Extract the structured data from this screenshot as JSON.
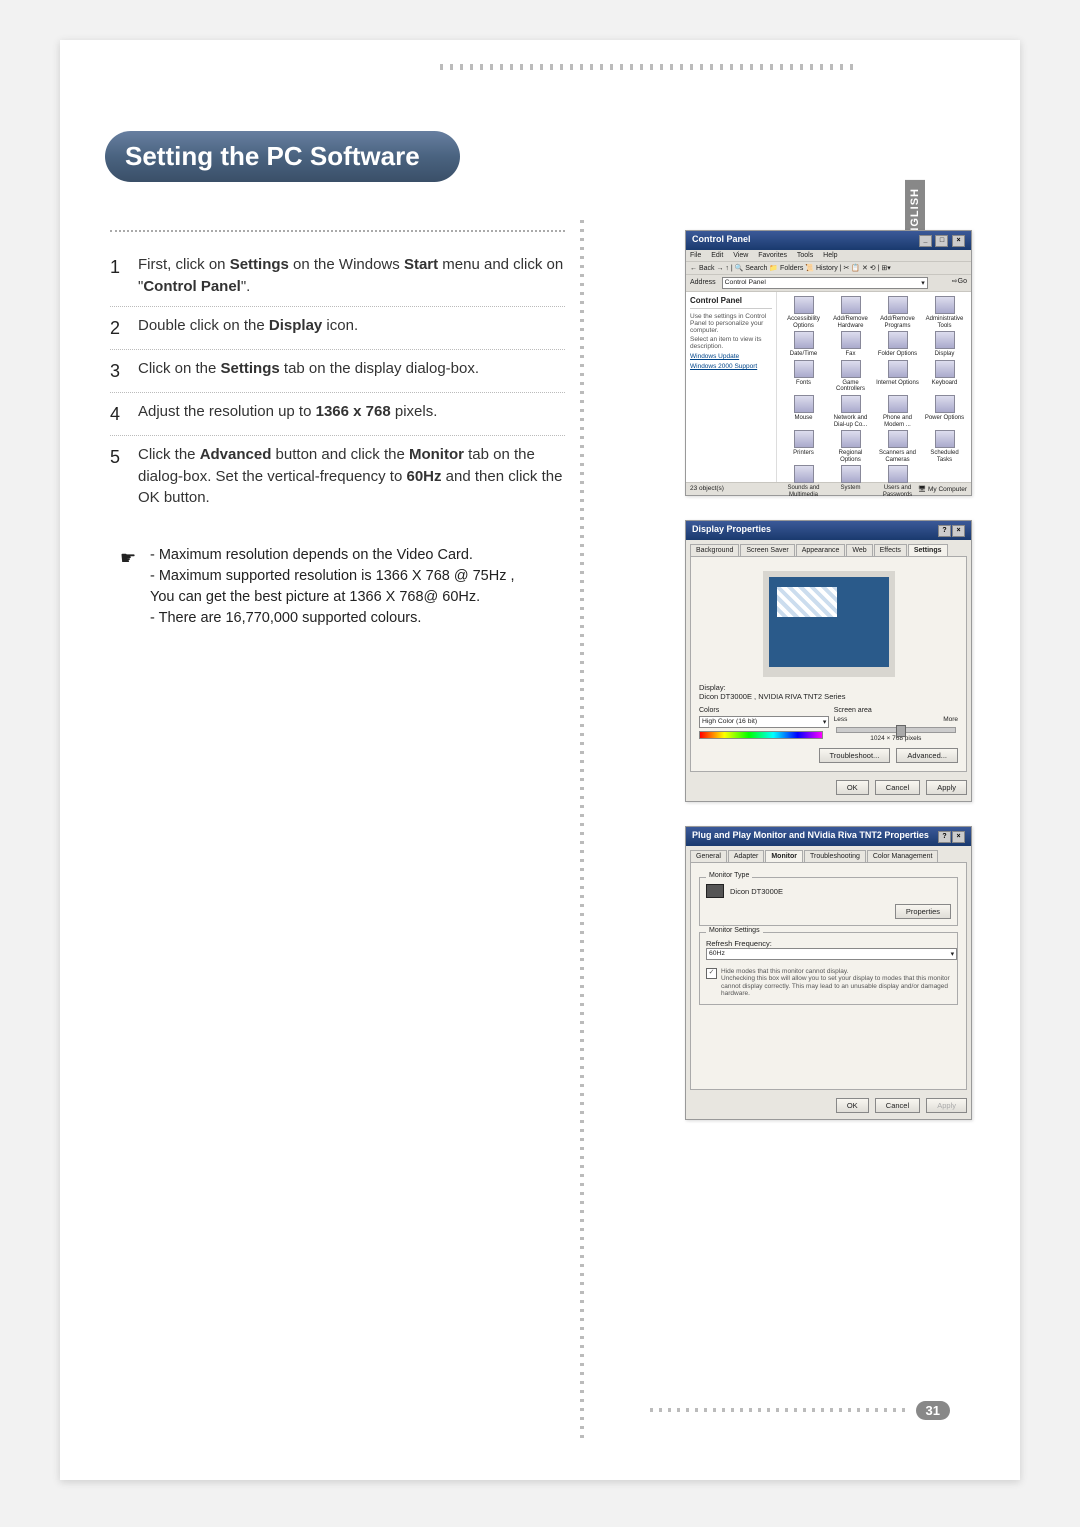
{
  "title": "Setting the PC Software",
  "language_tab": "ENGLISH",
  "page_number": "31",
  "steps": [
    {
      "n": "1",
      "text_pre": "First, click on ",
      "b1": "Settings",
      "mid1": " on the Windows ",
      "b2": "Start",
      "mid2": " menu and click on \"",
      "b3": "Control Panel",
      "post": "\"."
    },
    {
      "n": "2",
      "text_pre": "Double click on the ",
      "b1": "Display",
      "mid1": " icon.",
      "b2": "",
      "mid2": "",
      "b3": "",
      "post": ""
    },
    {
      "n": "3",
      "text_pre": "Click on the ",
      "b1": "Settings",
      "mid1": " tab on the display dialog-box.",
      "b2": "",
      "mid2": "",
      "b3": "",
      "post": ""
    },
    {
      "n": "4",
      "text_pre": "Adjust the resolution up to ",
      "b1": "1366 x 768",
      "mid1": " pixels.",
      "b2": "",
      "mid2": "",
      "b3": "",
      "post": ""
    },
    {
      "n": "5",
      "text_pre": "Click the ",
      "b1": "Advanced",
      "mid1": " button and click the ",
      "b2": "Monitor",
      "mid2": " tab on the dialog-box. Set the vertical-frequency to ",
      "b3": "60Hz",
      "post": " and then click the OK button."
    }
  ],
  "note": {
    "line1": "- Maximum resolution depends on the Video Card.",
    "line2": "- Maximum supported resolution is 1366 X 768 @ 75Hz ,",
    "line3": "  You can get the best picture at 1366 X 768@ 60Hz.",
    "line4": "- There are 16,770,000 supported colours."
  },
  "cp_dialog": {
    "title": "Control Panel",
    "menus": [
      "File",
      "Edit",
      "View",
      "Favorites",
      "Tools",
      "Help"
    ],
    "toolbar": "← Back  →  ↑  | 🔍 Search  📁 Folders  📜 History  | ✂ 📋 ✕ ⟲ | ⊞▾",
    "address_label": "Address",
    "address_value": "Control Panel",
    "side_title": "Control Panel",
    "side_desc": "Use the settings in Control Panel to personalize your computer.",
    "side_hint": "Select an item to view its description.",
    "side_links": [
      "Windows Update",
      "Windows 2000 Support"
    ],
    "icons": [
      "Accessibility Options",
      "Add/Remove Hardware",
      "Add/Remove Programs",
      "Administrative Tools",
      "Date/Time",
      "Fax",
      "Folder Options",
      "Display",
      "Fonts",
      "Game Controllers",
      "Internet Options",
      "Keyboard",
      "Mouse",
      "Network and Dial-up Co...",
      "Phone and Modem ...",
      "Power Options",
      "Printers",
      "Regional Options",
      "Scanners and Cameras",
      "Scheduled Tasks",
      "Sounds and Multimedia",
      "System",
      "Users and Passwords",
      ""
    ],
    "status_left": "23 object(s)",
    "status_right": "🖥 My Computer"
  },
  "dp_dialog": {
    "title": "Display Properties",
    "tabs": [
      "Background",
      "Screen Saver",
      "Appearance",
      "Web",
      "Effects",
      "Settings"
    ],
    "active_tab": "Settings",
    "display_label": "Display:",
    "display_value": "Dicon DT3000E , NVIDIA RIVA TNT2 Series",
    "colors_label": "Colors",
    "colors_value": "High Color (16 bit)",
    "area_label": "Screen area",
    "area_less": "Less",
    "area_more": "More",
    "area_value": "1024 × 768 pixels",
    "btn_trouble": "Troubleshoot...",
    "btn_advanced": "Advanced...",
    "btn_ok": "OK",
    "btn_cancel": "Cancel",
    "btn_apply": "Apply"
  },
  "mon_dialog": {
    "title": "Plug and Play Monitor and NVidia Riva TNT2 Properties",
    "tabs": [
      "General",
      "Adapter",
      "Monitor",
      "Troubleshooting",
      "Color Management"
    ],
    "active_tab": "Monitor",
    "type_legend": "Monitor Type",
    "type_value": "Dicon DT3000E",
    "btn_properties": "Properties",
    "settings_legend": "Monitor Settings",
    "refresh_label": "Refresh Frequency:",
    "refresh_value": "60Hz",
    "hide_label": "Hide modes that this monitor cannot display.",
    "hide_desc": "Unchecking this box will allow you to set your display to modes that this monitor cannot display correctly. This may lead to an unusable display and/or damaged hardware.",
    "btn_ok": "OK",
    "btn_cancel": "Cancel",
    "btn_apply": "Apply"
  }
}
